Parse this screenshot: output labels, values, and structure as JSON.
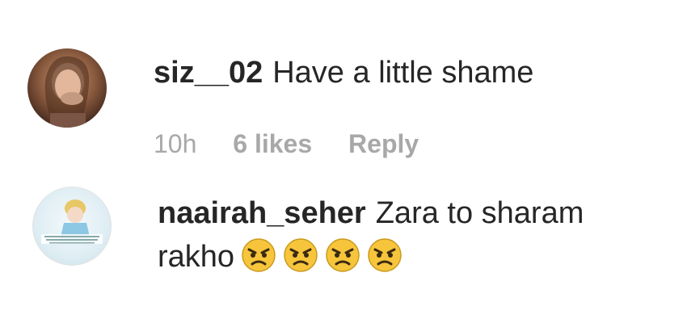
{
  "comments": [
    {
      "username": "siz__02",
      "text": "Have a little shame",
      "time": "10h",
      "likes": "6 likes",
      "reply": "Reply",
      "avatar_icon": "profile-photo-woman"
    },
    {
      "username": "naairah_seher",
      "text_line1": "Zara to sharam",
      "text_line2": "rakho",
      "emojis": [
        "angry-face-emoji",
        "angry-face-emoji",
        "angry-face-emoji",
        "angry-face-emoji"
      ],
      "avatar_icon": "profile-photo-cartoon"
    }
  ],
  "colors": {
    "username": "#262626",
    "meta": "#a8a8a8",
    "emoji_face": "#f7c53b"
  }
}
